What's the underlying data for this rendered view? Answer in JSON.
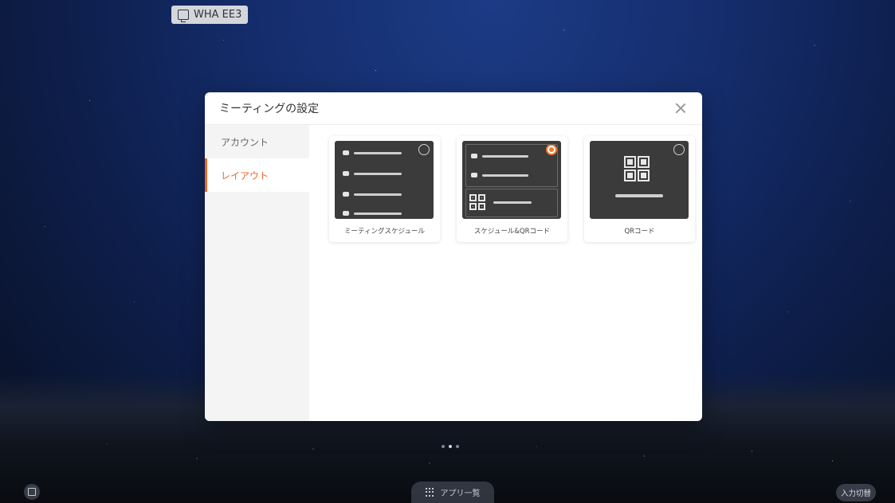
{
  "source_chip": {
    "label": "WHA EE3",
    "icon": "screen-share-icon"
  },
  "modal": {
    "title": "ミーティングの設定",
    "sidebar": [
      {
        "label": "アカウント",
        "active": false
      },
      {
        "label": "レイアウト",
        "active": true
      }
    ],
    "layouts": [
      {
        "label": "ミーティングスケジュール",
        "selected": false
      },
      {
        "label": "スケジュール&QRコード",
        "selected": true
      },
      {
        "label": "QRコード",
        "selected": false
      }
    ]
  },
  "bottom_bar": {
    "apps_label": "アプリ一覧",
    "input_label": "入力切替",
    "page_count": 3,
    "current_page": 2
  },
  "colors": {
    "accent": "#e8692a",
    "thumb_bg": "#3b3b3b"
  }
}
